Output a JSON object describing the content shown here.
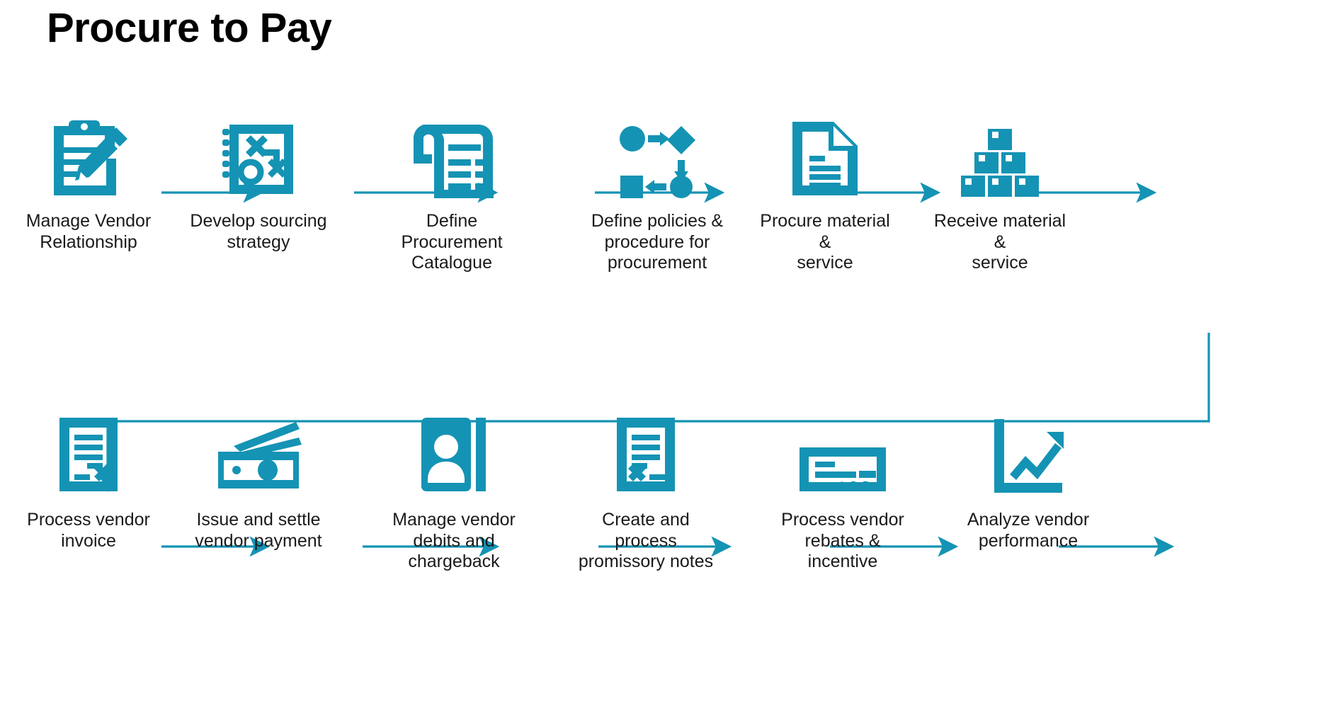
{
  "title": "Procure to Pay",
  "theme": {
    "accent": "#1593B4",
    "text": "#1a1a1a",
    "background": "#ffffff"
  },
  "diagram": {
    "type": "process-flow",
    "rows": 2,
    "nodes_per_row": 6,
    "flow_direction": "left-to-right, then wrap down to second row left-to-right",
    "nodes": [
      {
        "id": 1,
        "label": "Manage Vendor\nRelationship",
        "label_line1": "Manage Vendor",
        "label_line2": "Relationship",
        "label_line3": "",
        "icon": "clipboard-pencil-icon"
      },
      {
        "id": 2,
        "label": "Develop sourcing\nstrategy",
        "label_line1": "Develop sourcing",
        "label_line2": "strategy",
        "label_line3": "",
        "icon": "strategy-notepad-icon"
      },
      {
        "id": 3,
        "label": "Define Procurement\nCatalogue",
        "label_line1": "Define Procurement",
        "label_line2": "Catalogue",
        "label_line3": "",
        "icon": "receipt-scroll-icon"
      },
      {
        "id": 4,
        "label": "Define policies &\nprocedure for\nprocurement",
        "label_line1": "Define policies &",
        "label_line2": "procedure for",
        "label_line3": "procurement",
        "icon": "flowchart-icon"
      },
      {
        "id": 5,
        "label": "Procure material &\nservice",
        "label_line1": "Procure material &",
        "label_line2": "service",
        "label_line3": "",
        "icon": "document-page-icon"
      },
      {
        "id": 6,
        "label": "Receive material &\nservice",
        "label_line1": "Receive material &",
        "label_line2": "service",
        "label_line3": "",
        "icon": "box-stack-icon"
      },
      {
        "id": 7,
        "label": "Process vendor\ninvoice",
        "label_line1": "Process vendor",
        "label_line2": "invoice",
        "label_line3": "",
        "icon": "invoice-x-icon"
      },
      {
        "id": 8,
        "label": "Issue and settle\nvendor payment",
        "label_line1": "Issue and settle",
        "label_line2": "vendor payment",
        "label_line3": "",
        "icon": "cash-banknotes-icon"
      },
      {
        "id": 9,
        "label": "Manage vendor\ndebits and\nchargeback",
        "label_line1": "Manage vendor",
        "label_line2": "debits and",
        "label_line3": "chargeback",
        "icon": "contact-book-icon"
      },
      {
        "id": 10,
        "label": "Create and process\npromissory notes",
        "label_line1": "Create and process",
        "label_line2": "promissory notes",
        "label_line3": "",
        "icon": "promissory-note-icon"
      },
      {
        "id": 11,
        "label": "Process vendor\nrebates & incentive",
        "label_line1": "Process vendor",
        "label_line2": "rebates & incentive",
        "label_line3": "",
        "icon": "cheque-signature-icon"
      },
      {
        "id": 12,
        "label": "Analyze vendor\nperformance",
        "label_line1": "Analyze vendor",
        "label_line2": "performance",
        "label_line3": "",
        "icon": "line-chart-growth-icon"
      }
    ],
    "connectors": [
      {
        "from": 1,
        "to": 2,
        "style": "arrow-right"
      },
      {
        "from": 2,
        "to": 3,
        "style": "arrow-right"
      },
      {
        "from": 3,
        "to": 4,
        "style": "arrow-right"
      },
      {
        "from": 4,
        "to": 5,
        "style": "arrow-right"
      },
      {
        "from": 5,
        "to": 6,
        "style": "arrow-right"
      },
      {
        "from": 6,
        "to": 7,
        "style": "elbow-wrap-down-left"
      },
      {
        "from": 7,
        "to": 8,
        "style": "arrow-right"
      },
      {
        "from": 8,
        "to": 9,
        "style": "arrow-right"
      },
      {
        "from": 9,
        "to": 10,
        "style": "arrow-right"
      },
      {
        "from": 10,
        "to": 11,
        "style": "arrow-right"
      },
      {
        "from": 11,
        "to": 12,
        "style": "arrow-right"
      }
    ]
  }
}
